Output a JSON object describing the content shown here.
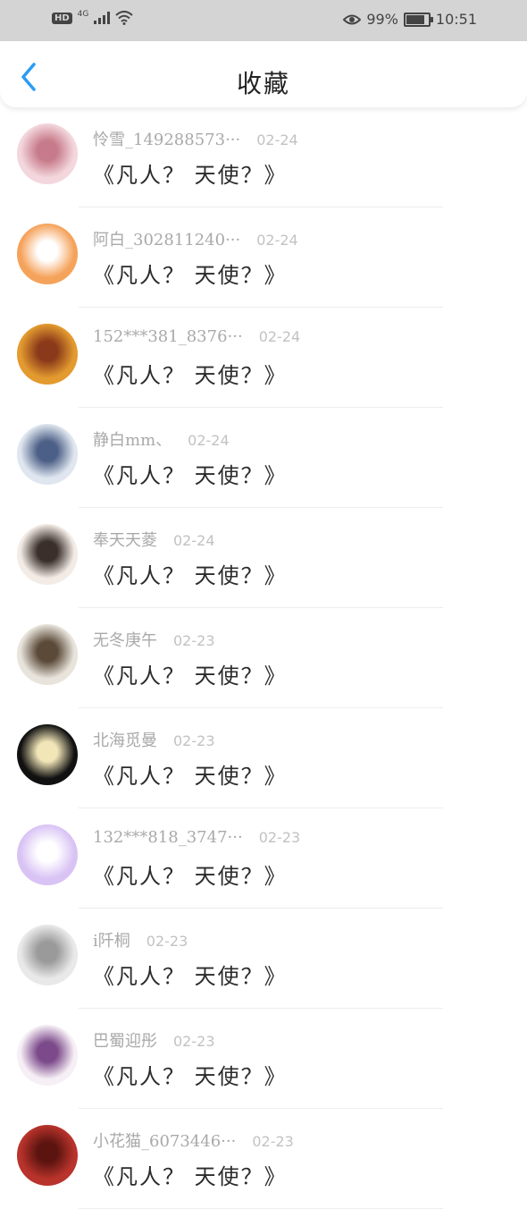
{
  "status_bar": {
    "hd": "HD",
    "network": "4G",
    "battery_percent": "99%",
    "time": "10:51"
  },
  "header": {
    "title": "收藏",
    "back_icon": "chevron-left-icon",
    "accent": "#2a9df4"
  },
  "items": [
    {
      "name": "怜雪_149288573···",
      "date": "02-24",
      "comment": "《凡人？ 天使？》",
      "avatar_colors": [
        "#f3d7dd",
        "#c77b8a"
      ]
    },
    {
      "name": "阿白_302811240···",
      "date": "02-24",
      "comment": "《凡人？ 天使？》",
      "avatar_colors": [
        "#f5a25a",
        "#ffffff"
      ]
    },
    {
      "name": "152***381_8376···",
      "date": "02-24",
      "comment": "《凡人？ 天使？》",
      "avatar_colors": [
        "#e39a2f",
        "#8a3a1a"
      ]
    },
    {
      "name": "静白mm、",
      "date": "02-24",
      "comment": "《凡人？ 天使？》",
      "avatar_colors": [
        "#dfe6ef",
        "#4c5f86"
      ]
    },
    {
      "name": "奉天天菱",
      "date": "02-24",
      "comment": "《凡人？ 天使？》",
      "avatar_colors": [
        "#f3ece6",
        "#3a2f2a"
      ]
    },
    {
      "name": "无冬庚午",
      "date": "02-23",
      "comment": "《凡人？ 天使？》",
      "avatar_colors": [
        "#e8e4dc",
        "#5b4a38"
      ]
    },
    {
      "name": "北海觅曼",
      "date": "02-23",
      "comment": "《凡人？ 天使？》",
      "avatar_colors": [
        "#111111",
        "#f2e6b8"
      ]
    },
    {
      "name": "132***818_3747···",
      "date": "02-23",
      "comment": "《凡人？ 天使？》",
      "avatar_colors": [
        "#d9c3f5",
        "#ffffff"
      ]
    },
    {
      "name": "i阡桐",
      "date": "02-23",
      "comment": "《凡人？ 天使？》",
      "avatar_colors": [
        "#e9e9e9",
        "#9a9a9a"
      ]
    },
    {
      "name": "巴蜀迎彤",
      "date": "02-23",
      "comment": "《凡人？ 天使？》",
      "avatar_colors": [
        "#f6eff6",
        "#7c4a8a"
      ]
    },
    {
      "name": "小花猫_6073446···",
      "date": "02-23",
      "comment": "《凡人？ 天使？》",
      "avatar_colors": [
        "#b8332b",
        "#5c1410"
      ]
    }
  ]
}
